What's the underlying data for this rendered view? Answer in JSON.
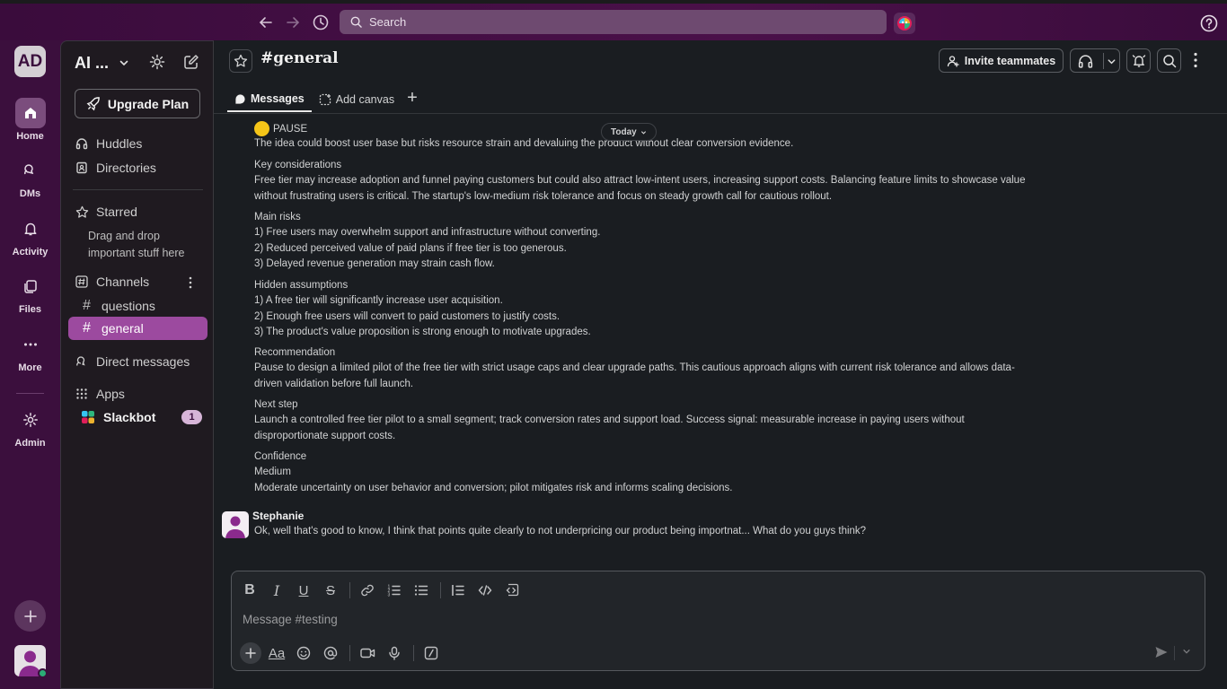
{
  "topbar": {
    "search_placeholder": "Search"
  },
  "rail": {
    "workspace_initials": "AD",
    "items": [
      {
        "label": "Home"
      },
      {
        "label": "DMs"
      },
      {
        "label": "Activity"
      },
      {
        "label": "Files"
      },
      {
        "label": "More"
      },
      {
        "label": "Admin"
      }
    ]
  },
  "sidebar": {
    "workspace_name": "AI ...",
    "upgrade_label": "Upgrade Plan",
    "huddles": "Huddles",
    "directories": "Directories",
    "starred": "Starred",
    "starred_hint": "Drag and drop important stuff here",
    "channels_header": "Channels",
    "channels": [
      {
        "name": "questions"
      },
      {
        "name": "general"
      }
    ],
    "direct_messages": "Direct messages",
    "apps": "Apps",
    "slackbot": "Slackbot",
    "slackbot_badge": "1"
  },
  "channel": {
    "name": "general",
    "invite_label": "Invite teammates",
    "tabs": {
      "messages": "Messages",
      "add_canvas": "Add canvas"
    }
  },
  "messages": {
    "date_divider": "Today",
    "bot_message": {
      "verdict": "PAUSE",
      "summary": "The idea could boost user base but risks resource strain and devaluing the product without clear conversion evidence.",
      "key_title": "Key considerations",
      "key_text": "Free tier may increase adoption and funnel paying customers but could also attract low-intent users, increasing support costs. Balancing feature limits to showcase value without frustrating users is critical. The startup's low-medium risk tolerance and focus on steady growth call for cautious rollout.",
      "risks_title": "Main risks",
      "risks": [
        "1) Free users may overwhelm support and infrastructure without converting.",
        "2) Reduced perceived value of paid plans if free tier is too generous.",
        "3) Delayed revenue generation may strain cash flow."
      ],
      "assumptions_title": "Hidden assumptions",
      "assumptions": [
        "1) A free tier will significantly increase user acquisition.",
        "2) Enough free users will convert to paid customers to justify costs.",
        "3) The product's value proposition is strong enough to motivate upgrades."
      ],
      "rec_title": "Recommendation",
      "rec_text": "Pause to design a limited pilot of the free tier with strict usage caps and clear upgrade paths. This cautious approach aligns with current risk tolerance and allows data-driven validation before full launch.",
      "next_title": "Next step",
      "next_text": "Launch a controlled free tier pilot to a small segment; track conversion rates and support load. Success signal: measurable increase in paying users without disproportionate support costs.",
      "conf_title": "Confidence",
      "conf_level": "Medium",
      "conf_text": "Moderate uncertainty on user behavior and conversion; pilot mitigates risk and informs scaling decisions."
    },
    "user_message": {
      "author": "Stephanie",
      "text": "Ok, well that's good to know, I think that points quite clearly to not underpricing our product being importnat... What do you guys think?"
    }
  },
  "composer": {
    "placeholder": "Message #testing"
  },
  "colors": {
    "aubergine": "#3b0f3d",
    "active_channel": "#9c4a9f",
    "main_bg": "#1a1d21",
    "pause_dot": "#f5c518",
    "online": "#2bac76"
  }
}
